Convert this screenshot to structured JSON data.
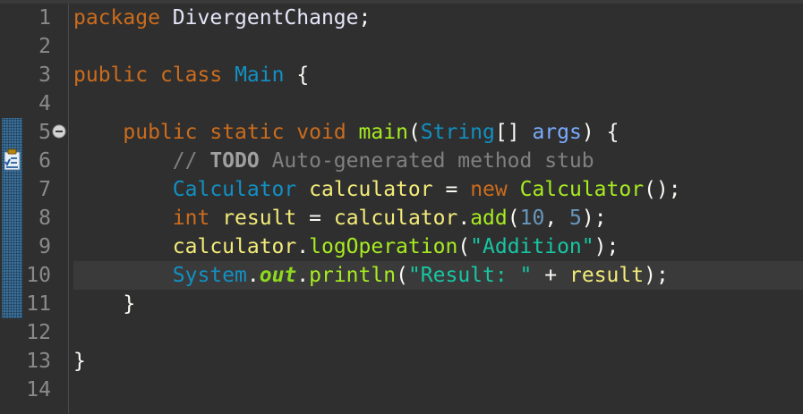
{
  "editor": {
    "lines": [
      {
        "num": "1",
        "tokens": [
          [
            "kw",
            "package"
          ],
          [
            "plain",
            " DivergentChange"
          ],
          [
            "punct",
            ";"
          ]
        ]
      },
      {
        "num": "2",
        "tokens": []
      },
      {
        "num": "3",
        "tokens": [
          [
            "kw",
            "public"
          ],
          [
            "plain",
            " "
          ],
          [
            "kw",
            "class"
          ],
          [
            "plain",
            " "
          ],
          [
            "cls",
            "Main"
          ],
          [
            "plain",
            " "
          ],
          [
            "punct",
            "{"
          ]
        ]
      },
      {
        "num": "4",
        "tokens": []
      },
      {
        "num": "5",
        "tokens": [
          [
            "plain",
            "    "
          ],
          [
            "kw",
            "public"
          ],
          [
            "plain",
            " "
          ],
          [
            "kw",
            "static"
          ],
          [
            "plain",
            " "
          ],
          [
            "kw",
            "void"
          ],
          [
            "plain",
            " "
          ],
          [
            "method",
            "main"
          ],
          [
            "punct",
            "("
          ],
          [
            "cls",
            "String"
          ],
          [
            "punct",
            "[]"
          ],
          [
            "plain",
            " "
          ],
          [
            "param",
            "args"
          ],
          [
            "punct",
            ")"
          ],
          [
            "plain",
            " "
          ],
          [
            "punct",
            "{"
          ]
        ]
      },
      {
        "num": "6",
        "tokens": [
          [
            "plain",
            "        "
          ],
          [
            "comment",
            "// "
          ],
          [
            "todo",
            "TODO"
          ],
          [
            "comment",
            " Auto-generated method stub"
          ]
        ]
      },
      {
        "num": "7",
        "tokens": [
          [
            "plain",
            "        "
          ],
          [
            "cls",
            "Calculator"
          ],
          [
            "plain",
            " "
          ],
          [
            "var",
            "calculator"
          ],
          [
            "plain",
            " "
          ],
          [
            "punct",
            "="
          ],
          [
            "plain",
            " "
          ],
          [
            "kw",
            "new"
          ],
          [
            "plain",
            " "
          ],
          [
            "method",
            "Calculator"
          ],
          [
            "punct",
            "();"
          ]
        ]
      },
      {
        "num": "8",
        "tokens": [
          [
            "plain",
            "        "
          ],
          [
            "kw",
            "int"
          ],
          [
            "plain",
            " "
          ],
          [
            "var",
            "result"
          ],
          [
            "plain",
            " "
          ],
          [
            "punct",
            "="
          ],
          [
            "plain",
            " "
          ],
          [
            "var",
            "calculator"
          ],
          [
            "punct",
            "."
          ],
          [
            "method",
            "add"
          ],
          [
            "punct",
            "("
          ],
          [
            "num",
            "10"
          ],
          [
            "punct",
            ","
          ],
          [
            "plain",
            " "
          ],
          [
            "num",
            "5"
          ],
          [
            "punct",
            ");"
          ]
        ]
      },
      {
        "num": "9",
        "tokens": [
          [
            "plain",
            "        "
          ],
          [
            "var",
            "calculator"
          ],
          [
            "punct",
            "."
          ],
          [
            "method",
            "logOperation"
          ],
          [
            "punct",
            "("
          ],
          [
            "str",
            "\"Addition\""
          ],
          [
            "punct",
            ");"
          ]
        ]
      },
      {
        "num": "10",
        "tokens": [
          [
            "plain",
            "        "
          ],
          [
            "cls",
            "System"
          ],
          [
            "punct",
            "."
          ],
          [
            "field",
            "out"
          ],
          [
            "punct",
            "."
          ],
          [
            "method",
            "println"
          ],
          [
            "punct",
            "("
          ],
          [
            "str",
            "\"Result: \""
          ],
          [
            "plain",
            " "
          ],
          [
            "punct",
            "+"
          ],
          [
            "plain",
            " "
          ],
          [
            "var",
            "result"
          ],
          [
            "punct",
            ");"
          ]
        ]
      },
      {
        "num": "11",
        "tokens": [
          [
            "plain",
            "    "
          ],
          [
            "punct",
            "}"
          ]
        ]
      },
      {
        "num": "12",
        "tokens": []
      },
      {
        "num": "13",
        "tokens": [
          [
            "punct",
            "}"
          ]
        ]
      },
      {
        "num": "14",
        "tokens": []
      }
    ],
    "current_line": "10",
    "colors": {
      "background": "#2f2f2f",
      "keyword": "#cc6c1d",
      "class": "#1290c3",
      "method": "#a7ec21",
      "variable": "#f3ec79",
      "parameter": "#79abff",
      "number": "#6897bb",
      "string": "#17c6a3",
      "comment": "#808080",
      "line_number": "#8a8a8a"
    },
    "icons": {
      "fold": "collapse-minus-icon",
      "task": "task-marker-icon"
    }
  }
}
